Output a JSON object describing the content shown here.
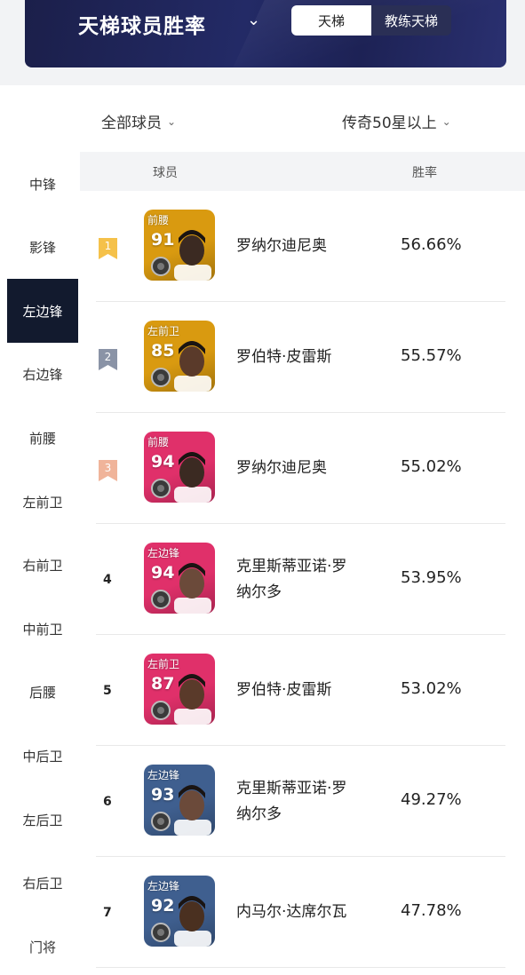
{
  "header": {
    "title": "天梯球员胜率",
    "tabs": [
      "天梯",
      "教练天梯"
    ],
    "active_tab": "天梯"
  },
  "filters": {
    "player_filter": "全部球员",
    "level_filter": "传奇50星以上"
  },
  "sidebar": {
    "items": [
      "中锋",
      "影锋",
      "左边锋",
      "右边锋",
      "前腰",
      "左前卫",
      "右前卫",
      "中前卫",
      "后腰",
      "中后卫",
      "左后卫",
      "右后卫",
      "门将"
    ],
    "active": "左边锋"
  },
  "table": {
    "col_player": "球员",
    "col_winrate": "胜率"
  },
  "rows": [
    {
      "rank": "1",
      "position": "前腰",
      "rating": "91",
      "name": "罗纳尔迪尼奥",
      "winrate": "56.66%",
      "card_color": "#d99a10",
      "flag_color": "#f5c14a"
    },
    {
      "rank": "2",
      "position": "左前卫",
      "rating": "85",
      "name": "罗伯特·皮雷斯",
      "winrate": "55.57%",
      "card_color": "#d99a10",
      "flag_color": "#8a93a6"
    },
    {
      "rank": "3",
      "position": "前腰",
      "rating": "94",
      "name": "罗纳尔迪尼奥",
      "winrate": "55.02%",
      "card_color": "#e0306a",
      "flag_color": "#f0b49a"
    },
    {
      "rank": "4",
      "position": "左边锋",
      "rating": "94",
      "name": "克里斯蒂亚诺·罗纳尔多",
      "winrate": "53.95%",
      "card_color": "#e0306a",
      "flag_color": ""
    },
    {
      "rank": "5",
      "position": "左前卫",
      "rating": "87",
      "name": "罗伯特·皮雷斯",
      "winrate": "53.02%",
      "card_color": "#e0306a",
      "flag_color": ""
    },
    {
      "rank": "6",
      "position": "左边锋",
      "rating": "93",
      "name": "克里斯蒂亚诺·罗纳尔多",
      "winrate": "49.27%",
      "card_color": "#3f5f8f",
      "flag_color": ""
    },
    {
      "rank": "7",
      "position": "左边锋",
      "rating": "92",
      "name": "内马尔·达席尔瓦",
      "winrate": "47.78%",
      "card_color": "#3f5f8f",
      "flag_color": ""
    }
  ]
}
